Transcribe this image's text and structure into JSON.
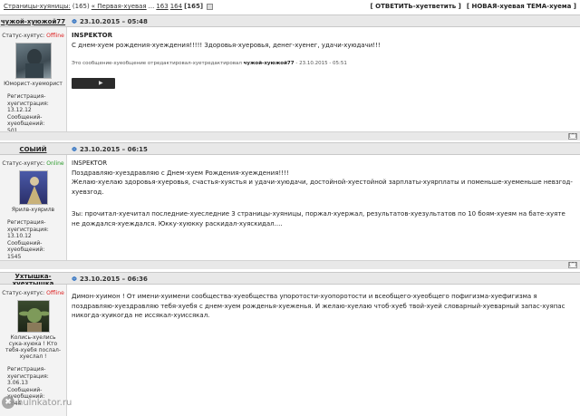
{
  "topbar": {
    "pages_label": "Страницы-хуяницы:",
    "pages_count": "(165)",
    "first_link": "« Первая-хуевая",
    "dots": "...",
    "page_163": "163",
    "page_164": "164",
    "current_page": "[165]",
    "reply_button": "[ ОТВЕТИТЬ-хуетветить ]",
    "new_topic_button": "[ НОВАЯ-хуевая ТЕМА-хуема ]"
  },
  "posts": [
    {
      "author": "чужой-хуюжой77",
      "date": "23.10.2015 – 05:48",
      "status_label": "Статус-хуятус:",
      "status_value": "Offline",
      "title": "Юморист-хуеморист",
      "reg_label": "Регистрация-хуегистрация:",
      "reg_date": "13.12.12",
      "msgs_label": "Сообщений-хуеобщений:",
      "msgs_count": "501",
      "quote_name": "INSPEKTOR",
      "text": "С днем-хуем рождения-хуеждения!!!!! Здоровья-хуеровья, денег-хуенег, удачи-хуюдачи!!!",
      "edited_prefix": "Это сообщение-хуеобщение отредактировал-хуетредактировал",
      "edited_by": "чужой-хуюжой77",
      "edited_date": " - 23.10.2015 - 05:51"
    },
    {
      "author": "СОЫИЙ",
      "date": "23.10.2015 – 06:15",
      "status_label": "Статус-хуятус:",
      "status_value": "Online",
      "title": "Ярилв-хуярилв",
      "reg_label": "Регистрация-хуегистрация:",
      "reg_date": "13.10.12",
      "msgs_label": "Сообщений-хуеобщений:",
      "msgs_count": "1545",
      "quote_name": "INSPEKTOR",
      "line1": "Поздравляю-хуездравляю с Днем-хуем Рождения-хуеждения!!!!",
      "line2": "Желаю-хуелаю здоровья-хуеровья, счастья-хуястья и удачи-хуюдачи, достойной-хуестойной зарплаты-хуярплаты и поменьше-хуеменьше невзгод-хуевзгод.",
      "line3": "Зы: прочитал-хуечитал последние-хуеследние 3 страницы-хуяницы, поржал-хуержал, результатов-хуезультатов по 10 боям-хуеям на бате-хуяте не дождался-хуеждался. Юкку-хуюкку раскидал-хуяскидал...."
    },
    {
      "author": "Ухтышка-хуехтышка",
      "date": "23.10.2015 – 06:36",
      "status_label": "Статус-хуятус:",
      "status_value": "Offline",
      "title": "Колись-хуелись сука-хуюка ! Кто тебя-хуебя послал-хуеслал !",
      "reg_label": "Регистрация-хуегистрация:",
      "reg_date": "3.06.13",
      "msgs_label": "Сообщений-хуеобщений:",
      "msgs_count": "3844",
      "text": "Димон-хуимон ! От имени-хуимени сообщества-хуеобщества упоротости-хуопоротости и всеобщего-хуеобщего пофигизма-хуефигизма я поздравляю-хуездравляю тебя-хуебя с днем-хуем рожденья-хуеженья. И желаю-хуелаю чтоб-хуеб твой-хуей словарный-хуеварный запас-хуяпас никогда-хуикогда не иссякал-хуиссякал."
    }
  ],
  "footer_up": "[^]",
  "watermark": "hulnkator.ru",
  "colors": {
    "offline": "#dd2222",
    "online": "#2a9a2a",
    "header_bg": "#e8e8e8",
    "sidebar_bg": "#f3f3f3",
    "pin": "#3a78c3"
  }
}
